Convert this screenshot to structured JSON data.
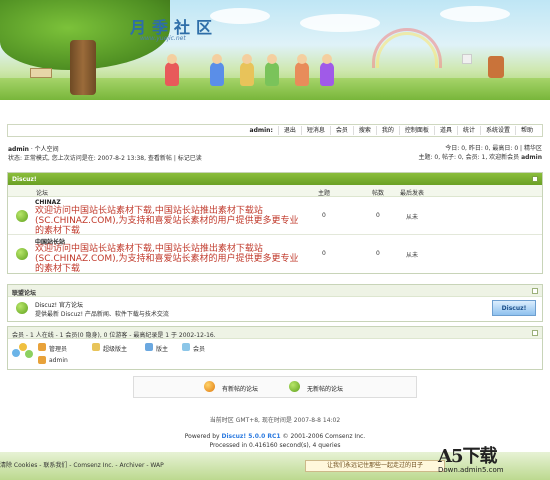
{
  "banner": {
    "logo_text": "月季社区",
    "logo_url": "www.yuejic.net"
  },
  "nav": {
    "user": "admin:",
    "items": [
      "退出",
      "短消息",
      "会员",
      "搜索",
      "我的",
      "控制面板",
      "道具",
      "统计",
      "系统设置",
      "帮助"
    ]
  },
  "crumbs": {
    "user": "admin",
    "space": "· 个人空间"
  },
  "status": "状态: 正常模式, 您上次访问是在: 2007-8-2 13:38, 查看新帖 | 标记已读",
  "stats": {
    "line1": "今日: 0, 昨日: 0, 最高日: 0 | 精华区",
    "line2_prefix": "主题: 0, 帖子: 0, 会员: 1, 欢迎新会员",
    "line2_user": "admin"
  },
  "category": {
    "title": "Discuz!",
    "columns": [
      "论坛",
      "主题",
      "帖数",
      "最后发表"
    ]
  },
  "forums": [
    {
      "name": "CHINAZ",
      "desc": "欢迎访问中国站长站素材下载,中国站长站推出素材下载站(SC.CHINAZ.COM),为支持和喜爱站长素材的用户提供更多更专业的素材下载",
      "topics": "0",
      "posts": "0",
      "last": "从未"
    },
    {
      "name": "中国站长站",
      "desc": "欢迎访问中国站长站素材下载,中国站长站推出素材下载站(SC.CHINAZ.COM),为支持和喜爱站长素材的用户提供更多更专业的素材下载",
      "topics": "0",
      "posts": "0",
      "last": "从未"
    }
  ],
  "partners": {
    "title": "联盟论坛",
    "name": "Discuz! 官方论坛",
    "desc": "提供最新 Discuz! 产品新闻、软件下载与技术交流",
    "logo_text": "Discuz!"
  },
  "online": {
    "header": "会员 - 1 人在线 - 1 会员(0 隐身), 0 位游客 - 最高纪录是 1 于 2002-12-16.",
    "legend": [
      "管理员",
      "超级版主",
      "版主",
      "会员"
    ],
    "users": [
      "admin"
    ]
  },
  "newposts": {
    "has_new": "有新帖的论坛",
    "no_new": "无新帖的论坛"
  },
  "footer": {
    "time": "当前时区 GMT+8, 现在时间是 2007-8-8 14:02",
    "powered_prefix": "Powered by",
    "powered_product": "Discuz! 5.0.0 RC1",
    "powered_suffix": "© 2001-2006 Comsenz Inc.",
    "processed": "Processed in 0.416160 second(s), 4 queries",
    "links": "清除 Cookies - 联系我们 - Comsenz Inc. - Archiver - WAP",
    "slogan": "让我们永远记住那些一起走过的日子"
  },
  "watermark": {
    "brand": "A5下载",
    "domain": "Down.admin5.com"
  },
  "colors": {
    "accent_green": "#6aa024",
    "desc_red": "#c0392b",
    "link_blue": "#2d7be0"
  }
}
